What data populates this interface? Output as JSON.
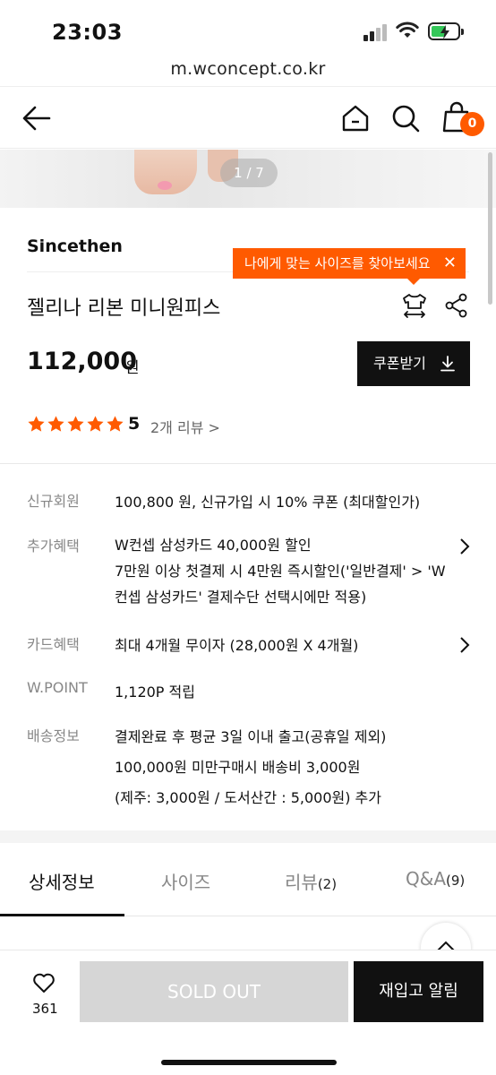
{
  "status_bar": {
    "time": "23:03"
  },
  "browser": {
    "url": "m.wconcept.co.kr"
  },
  "header": {
    "cart_count": "0"
  },
  "gallery": {
    "pager": "1 / 7"
  },
  "product": {
    "brand": "Sincethen",
    "name": "젤리나 리본 미니원피스",
    "price": "112,000",
    "price_unit": "원",
    "coupon_label": "쿠폰받기",
    "size_tooltip": "나에게 맞는 사이즈를 찾아보세요",
    "tooltip_close": "✕",
    "rating": 5,
    "rating_label": "5",
    "review_link": "2개 리뷰 >"
  },
  "info": {
    "member": {
      "label": "신규회원",
      "value": "100,800 원, 신규가입 시 10% 쿠폰 (최대할인가)"
    },
    "extra": {
      "label": "추가혜택",
      "lines": [
        "W컨셉 삼성카드 40,000원 할인",
        "7만원 이상 첫결제 시 4만원 즉시할인('일반결제' > 'W",
        "컨셉 삼성카드' 결제수단 선택시에만 적용)"
      ]
    },
    "card": {
      "label": "카드혜택",
      "value": "최대 4개월 무이자 (28,000원 X 4개월)"
    },
    "point": {
      "label": "W.POINT",
      "value": "1,120P 적립"
    },
    "shipping": {
      "label": "배송정보",
      "lines": [
        "결제완료 후 평균 3일 이내 출고(공휴일 제외)",
        "100,000원 미만구매시 배송비 3,000원",
        "(제주: 3,000원 / 도서산간 : 5,000원) 추가"
      ]
    }
  },
  "tabs": [
    {
      "label": "상세정보",
      "count": ""
    },
    {
      "label": "사이즈",
      "count": ""
    },
    {
      "label": "리뷰",
      "count": "(2)"
    },
    {
      "label": "Q&A",
      "count": "(9)"
    }
  ],
  "bottom_bar": {
    "like_count": "361",
    "sold_out_label": "SOLD OUT",
    "restock_label": "재입고 알림"
  },
  "colors": {
    "accent": "#ff5a00",
    "dark": "#111111",
    "disabled": "#d6d6d6",
    "star": "#ff5a00"
  },
  "icons": [
    "back-arrow-icon",
    "home-icon",
    "search-icon",
    "shopping-bag-icon",
    "size-guide-icon",
    "share-icon",
    "download-icon",
    "star-icon",
    "chevron-right-icon",
    "chevron-up-icon",
    "heart-icon"
  ]
}
